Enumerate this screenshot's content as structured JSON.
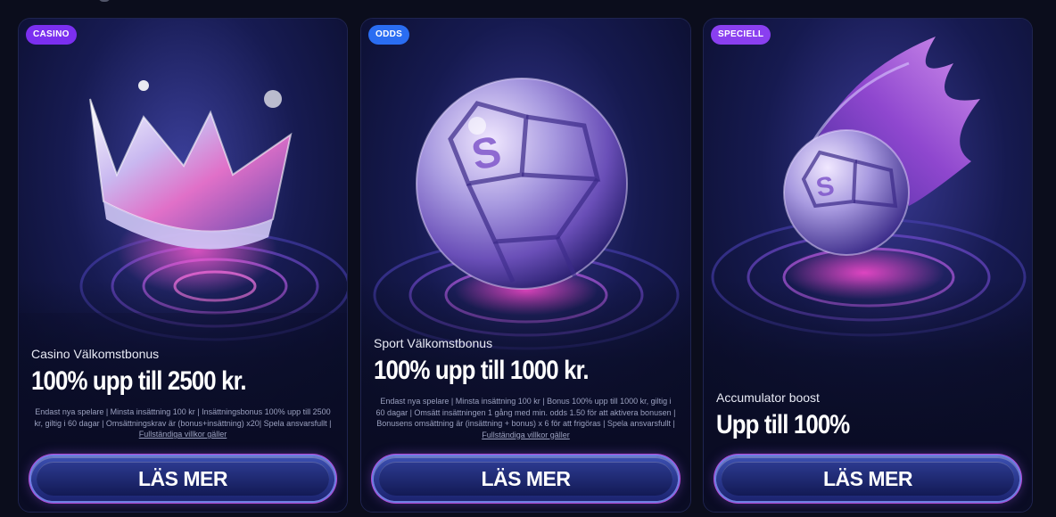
{
  "cards": [
    {
      "badge": "CASINO",
      "badge_color": "#7b2ff0",
      "art_icon": "crown-icon",
      "subtitle": "Casino Välkomstbonus",
      "headline": "100% upp till 2500 kr.",
      "terms": "Endast nya spelare | Minsta insättning 100 kr | Insättningsbonus 100% upp till 2500 kr, giltig i 60 dagar | Omsättningskrav är (bonus+insättning) x20| Spela ansvarsfullt |",
      "terms_link": "Fullständiga villkor gäller",
      "cta": "LÄS MER"
    },
    {
      "badge": "ODDS",
      "badge_color": "#2a6df2",
      "art_icon": "football-icon",
      "subtitle": "Sport Välkomstbonus",
      "headline": "100% upp till 1000 kr.",
      "terms": "Endast nya spelare | Minsta insättning 100 kr | Bonus 100% upp till 1000 kr, giltig i 60 dagar | Omsätt insättningen 1 gång med min. odds 1.50 för att aktivera bonusen | Bonusens omsättning är (insättning + bonus) x 6 för att frigöras | Spela ansvarsfullt |",
      "terms_link": "Fullständiga villkor gäller",
      "cta": "LÄS MER"
    },
    {
      "badge": "SPECIELL",
      "badge_color": "#8a3ff0",
      "art_icon": "flaming-football-icon",
      "subtitle": "Accumulator boost",
      "headline": "Upp till 100%",
      "cta": "LÄS MER"
    }
  ]
}
